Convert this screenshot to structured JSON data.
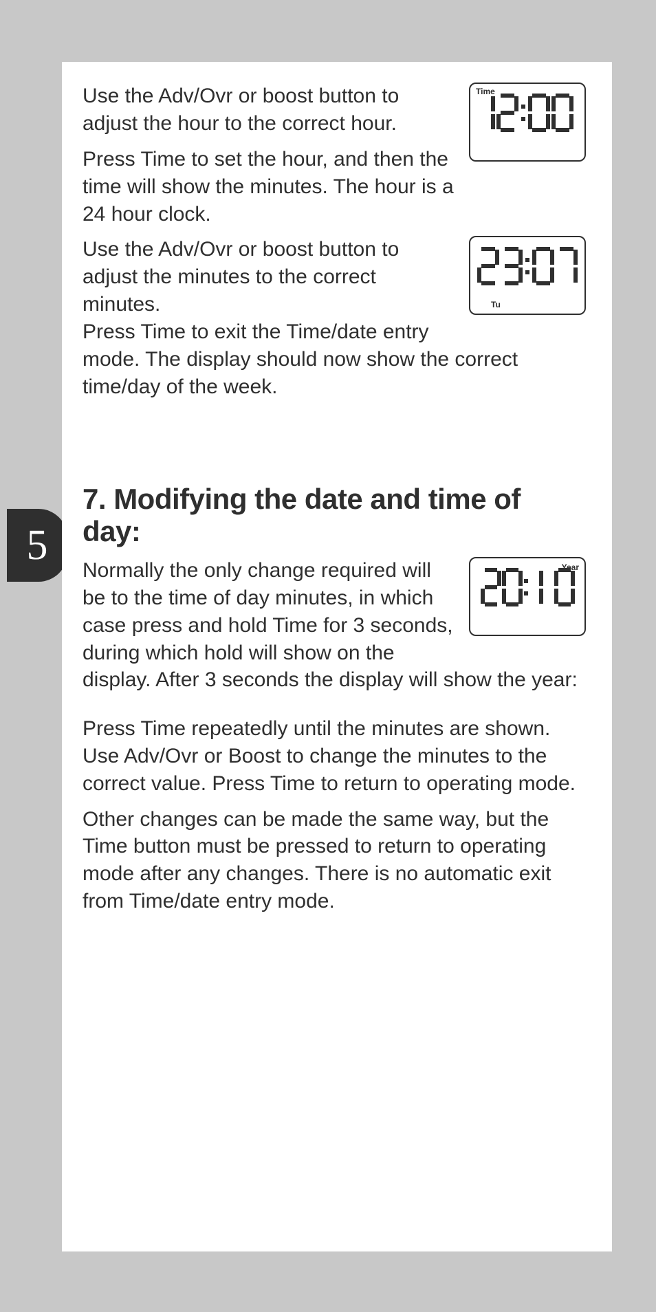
{
  "page_number": "5",
  "paragraphs": {
    "p1": "Use the Adv/Ovr or boost button to adjust the hour to the correct hour.",
    "p2": "Press Time to set the hour, and then the time will show the minutes. The hour is a 24 hour clock.",
    "p3": "Use the Adv/Ovr or boost button to adjust the minutes to the correct minutes.",
    "p4": "Press Time to exit the Time/date entry mode. The display should now show the correct time/day of the week.",
    "p5": "Normally the only change required will be to the time of day minutes, in which case press and hold Time for 3 seconds, during which hold will show on the display. After 3 seconds the display will show the year:",
    "p6": "Press Time repeatedly until the minutes are shown. Use Adv/Ovr or Boost to change the minutes to the correct value. Press Time to return to operating mode.",
    "p7": "Other changes can be made the same way, but the Time button must be pressed to return to operating mode after any changes. There is no automatic exit from Time/date entry mode."
  },
  "heading": "7. Modifying the date and time of day:",
  "displays": {
    "d1": {
      "label_top_left": "Time",
      "value": "12:00"
    },
    "d2": {
      "value": "23:07",
      "label_bottom": "Tu"
    },
    "d3": {
      "label_top_right": "Year",
      "value_left": "20:1",
      "value_right": "0"
    }
  }
}
